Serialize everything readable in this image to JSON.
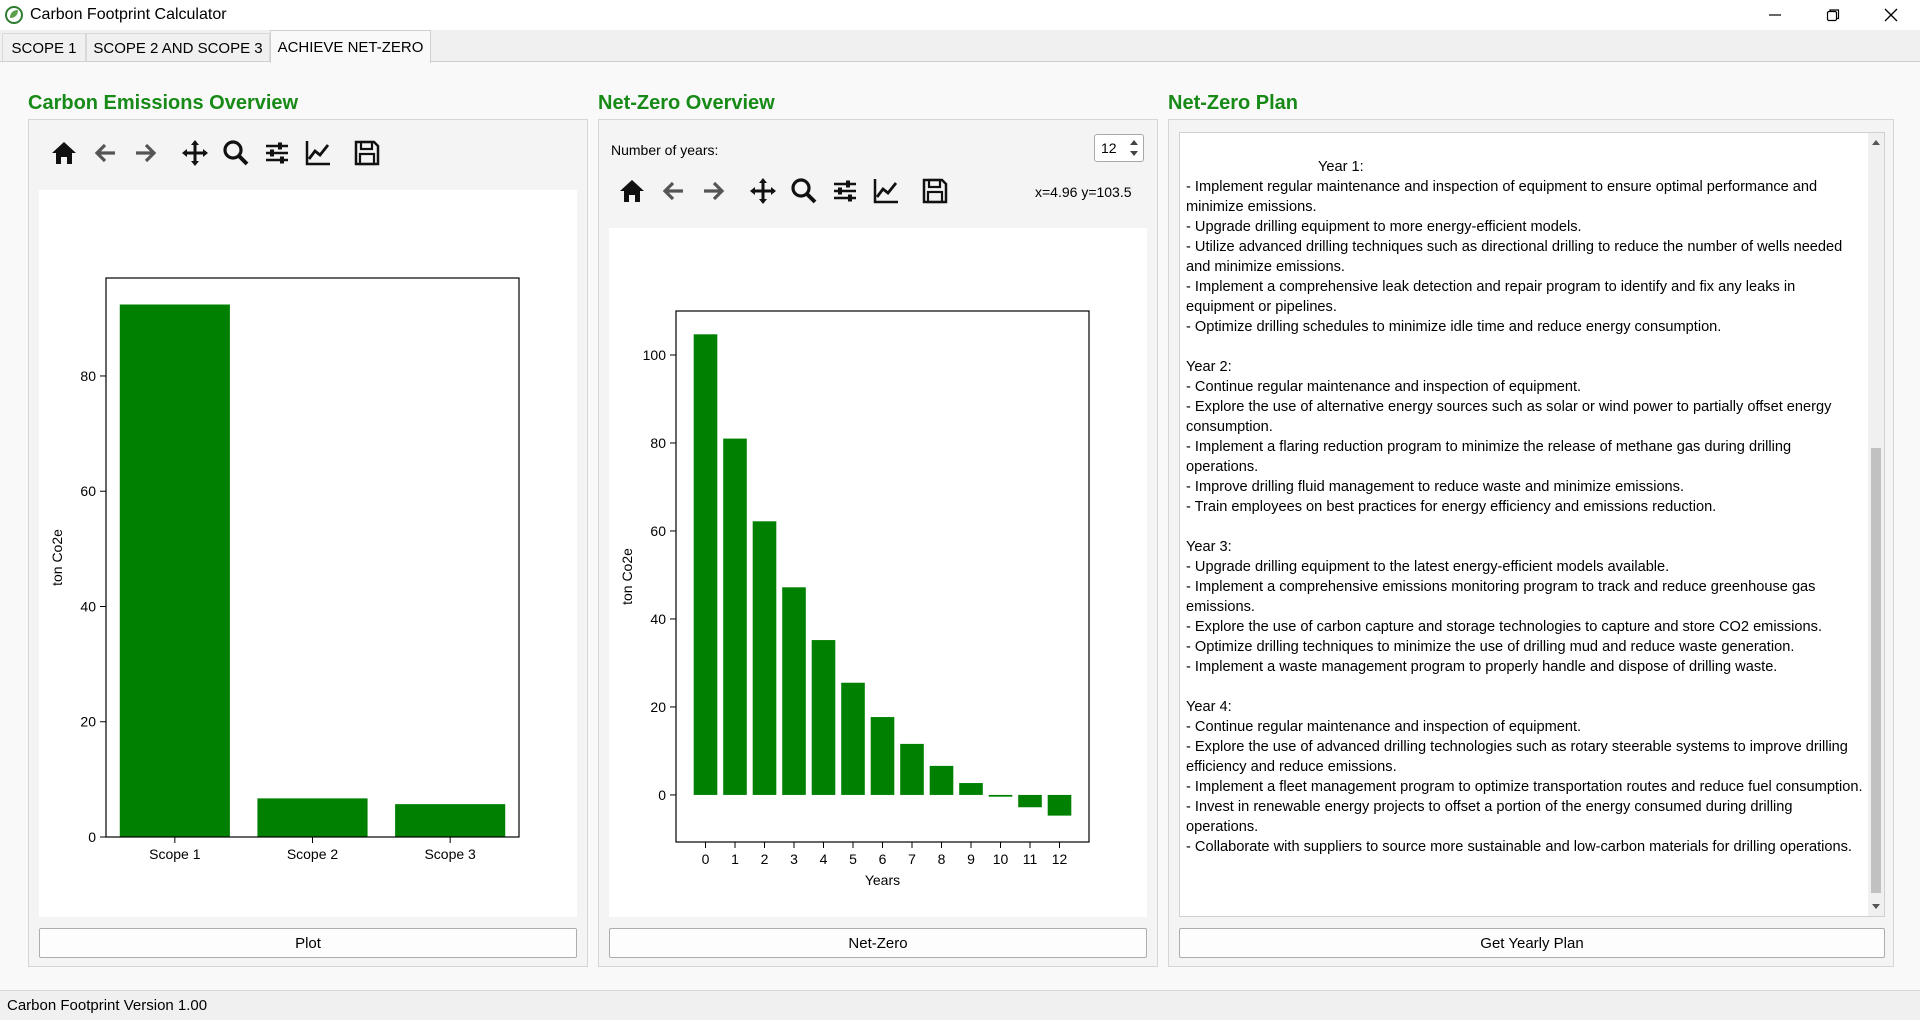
{
  "window": {
    "title": "Carbon Footprint Calculator"
  },
  "tabs": [
    {
      "label": "SCOPE 1",
      "active": false
    },
    {
      "label": "SCOPE 2 AND SCOPE 3",
      "active": false
    },
    {
      "label": "ACHIEVE NET-ZERO",
      "active": true
    }
  ],
  "emissions_panel": {
    "title": "Carbon Emissions Overview",
    "plot_button": "Plot"
  },
  "netzero_panel": {
    "title": "Net-Zero Overview",
    "years_label": "Number of years:",
    "years_value": "12",
    "coordinates": "x=4.96 y=103.5",
    "netzero_button": "Net-Zero"
  },
  "plan_panel": {
    "title": "Net-Zero Plan",
    "button": "Get Yearly Plan",
    "lines": [
      "Year 1:",
      "- Implement regular maintenance and inspection of equipment to ensure optimal performance and minimize emissions.",
      "- Upgrade drilling equipment to more energy-efficient models.",
      "- Utilize advanced drilling techniques such as directional drilling to reduce the number of wells needed and minimize emissions.",
      "- Implement a comprehensive leak detection and repair program to identify and fix any leaks in equipment or pipelines.",
      "- Optimize drilling schedules to minimize idle time and reduce energy consumption.",
      "",
      "Year 2:",
      "- Continue regular maintenance and inspection of equipment.",
      "- Explore the use of alternative energy sources such as solar or wind power to partially offset energy consumption.",
      "- Implement a flaring reduction program to minimize the release of methane gas during drilling operations.",
      "- Improve drilling fluid management to reduce waste and minimize emissions.",
      "- Train employees on best practices for energy efficiency and emissions reduction.",
      "",
      "Year 3:",
      "- Upgrade drilling equipment to the latest energy-efficient models available.",
      "- Implement a comprehensive emissions monitoring program to track and reduce greenhouse gas emissions.",
      "- Explore the use of carbon capture and storage technologies to capture and store CO2 emissions.",
      "- Optimize drilling techniques to minimize the use of drilling mud and reduce waste generation.",
      "- Implement a waste management program to properly handle and dispose of drilling waste.",
      "",
      "Year 4:",
      "- Continue regular maintenance and inspection of equipment.",
      "- Explore the use of advanced drilling technologies such as rotary steerable systems to improve drilling efficiency and reduce emissions.",
      "- Implement a fleet management program to optimize transportation routes and reduce fuel consumption.",
      "- Invest in renewable energy projects to offset a portion of the energy consumed during drilling operations.",
      "- Collaborate with suppliers to source more sustainable and low-carbon materials for drilling operations."
    ]
  },
  "statusbar": {
    "text": "Carbon Footprint Version 1.00"
  },
  "colors": {
    "bar": "#008000",
    "title": "#178a17"
  },
  "icons": [
    "home-icon",
    "back-arrow-icon",
    "forward-arrow-icon",
    "pan-icon",
    "zoom-icon",
    "configure-subplots-icon",
    "edit-axis-icon",
    "save-icon"
  ],
  "chart_data": [
    {
      "type": "bar",
      "categories": [
        "Scope 1",
        "Scope 2",
        "Scope 3"
      ],
      "values": [
        92.4,
        6.7,
        5.7
      ],
      "ylabel": "ton Co2e",
      "xlabel": "",
      "ylim": [
        0,
        97.0
      ],
      "yticks": [
        0,
        20,
        40,
        60,
        80
      ],
      "grid": false
    },
    {
      "type": "bar",
      "categories": [
        "0",
        "1",
        "2",
        "3",
        "4",
        "5",
        "6",
        "7",
        "8",
        "9",
        "10",
        "11",
        "12"
      ],
      "values": [
        104.7,
        81.0,
        62.2,
        47.2,
        35.2,
        25.5,
        17.7,
        11.6,
        6.6,
        2.7,
        -0.4,
        -2.8,
        -4.7
      ],
      "xlabel": "Years",
      "ylabel": "ton Co2e",
      "ylim": [
        -10.7,
        110.0
      ],
      "yticks": [
        0,
        20,
        40,
        60,
        80,
        100
      ],
      "grid": false
    }
  ]
}
